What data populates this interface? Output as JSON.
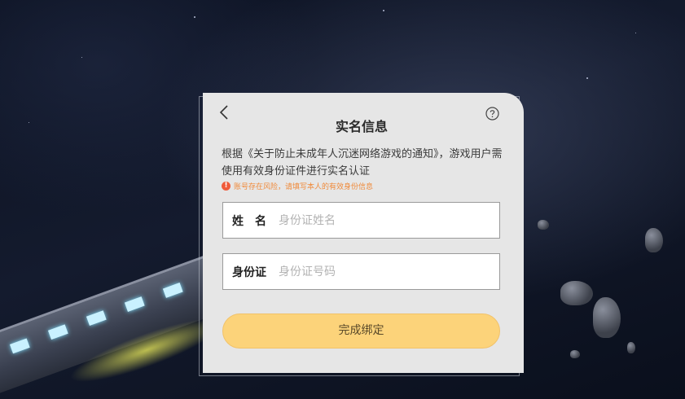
{
  "dialog": {
    "title": "实名信息",
    "back_icon": "chevron-left-icon",
    "help_icon": "help-icon",
    "notice": "根据《关于防止未成年人沉迷网络游戏的通知》，游戏用户需使用有效身份证件进行实名认证",
    "warning": {
      "icon_text": "!",
      "text": "账号存在风险，请填写本人的有效身份信息"
    },
    "fields": [
      {
        "label": "姓　名",
        "placeholder": "身份证姓名",
        "value": ""
      },
      {
        "label": "身份证",
        "placeholder": "身份证号码",
        "value": ""
      }
    ],
    "submit_label": "完成绑定"
  },
  "colors": {
    "dialog_bg": "#e6e6e6",
    "button_bg": "#fcd37a",
    "warning": "#f05a3a"
  }
}
